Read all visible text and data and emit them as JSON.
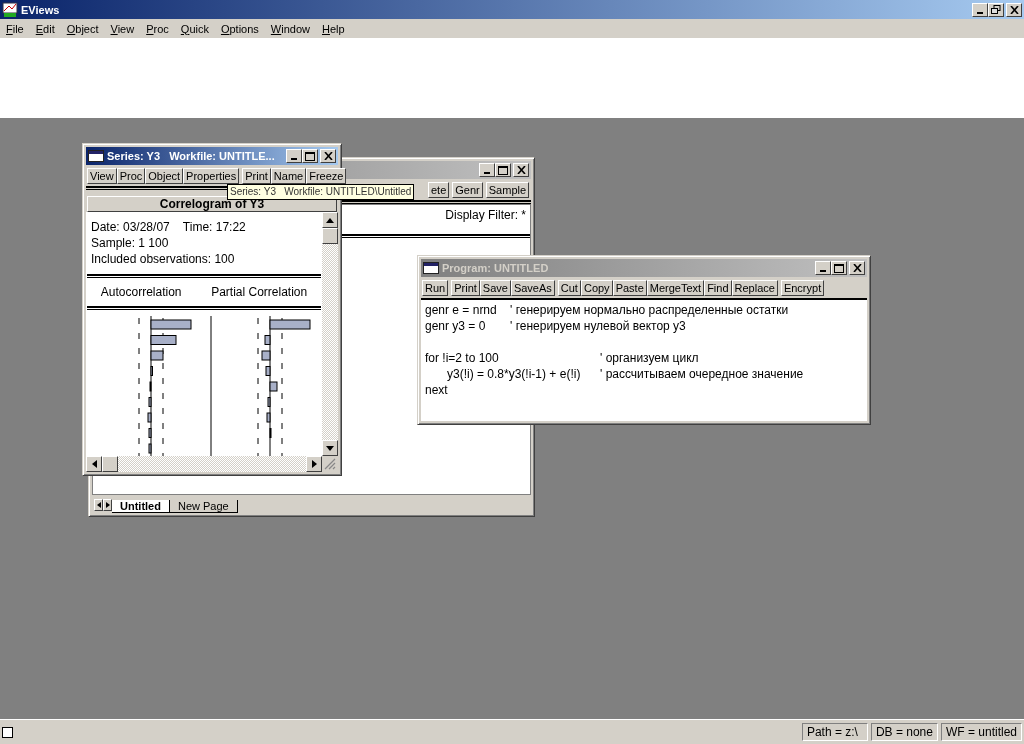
{
  "app_window": {
    "title": "EViews",
    "active": true
  },
  "menu": [
    "File",
    "Edit",
    "Object",
    "View",
    "Proc",
    "Quick",
    "Options",
    "Window",
    "Help"
  ],
  "workfile_window": {
    "active": false,
    "toolbar": [
      "ete",
      "Genr",
      "Sample"
    ],
    "display_filter": "Display Filter: *",
    "tabs": [
      {
        "label": "Untitled",
        "selected": true
      },
      {
        "label": "New Page",
        "selected": false
      }
    ]
  },
  "program_window": {
    "title": "Program: UNTITLED",
    "active": false,
    "toolbar": [
      [
        "Run"
      ],
      [
        "Print",
        "Save",
        "SaveAs"
      ],
      [
        "Cut",
        "Copy",
        "Paste",
        "MergeText",
        "Find",
        "Replace"
      ],
      [
        "Encrypt"
      ]
    ],
    "code_blocks": [
      [
        {
          "code": "genr e = nrnd",
          "comment": "' генерируем нормально распределенные остатки"
        },
        {
          "code": "genr y3 = 0",
          "comment": "' генерируем нулевой вектор y3"
        }
      ],
      [
        {
          "code": "for !i=2 to 100",
          "comment": "' организуем цикл",
          "indent": false
        },
        {
          "code": "y3(!i) = 0.8*y3(!i-1) + e(!i)",
          "comment": "' рассчитываем очередное значение",
          "indent": true
        },
        {
          "code": "next",
          "indent": false
        }
      ]
    ]
  },
  "series_window": {
    "title": "Series: Y3   Workfile: UNTITLE...",
    "active": true,
    "toolbar": [
      [
        "View",
        "Proc",
        "Object",
        "Properties"
      ],
      [
        "Print",
        "Name",
        "Freeze"
      ]
    ],
    "header": "Correlogram of Y3",
    "info": [
      "Date: 03/28/07    Time: 17:22",
      "Sample: 1 100",
      "Included observations: 100"
    ],
    "columns": [
      "Autocorrelation",
      "Partial Correlation"
    ]
  },
  "tooltip": "Series: Y3   Workfile: UNTITLED\\Untitled",
  "status_bar": [
    "Path = z:\\",
    "DB = none",
    "WF = untitled"
  ]
}
